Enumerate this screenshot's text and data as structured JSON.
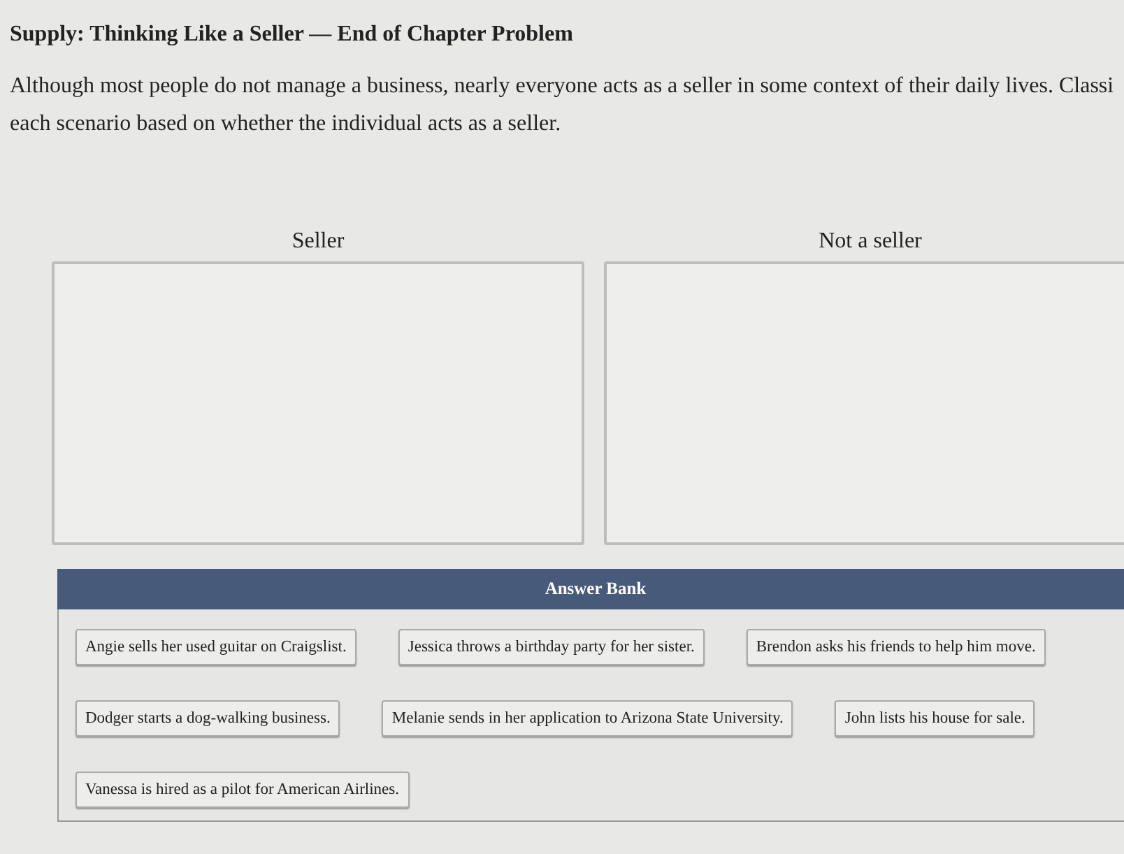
{
  "title": "Supply: Thinking Like a Seller — End of Chapter Problem",
  "instructions_lines": [
    "Although most people do not manage a business, nearly everyone acts as a seller in some context of their daily lives. Classi",
    "each scenario based on whether the individual acts as a seller."
  ],
  "bins": [
    {
      "label": "Seller"
    },
    {
      "label": "Not a seller"
    }
  ],
  "answer_bank": {
    "title": "Answer Bank",
    "rows": [
      [
        "Angie sells her used guitar on Craigslist.",
        "Jessica throws a birthday party for her sister.",
        "Brendon asks his friends to help him move."
      ],
      [
        "Dodger starts a dog-walking business.",
        "Melanie sends in her application to Arizona State University.",
        "John lists his house for sale."
      ],
      [
        "Vanessa is hired as a pilot for American Airlines."
      ]
    ]
  }
}
